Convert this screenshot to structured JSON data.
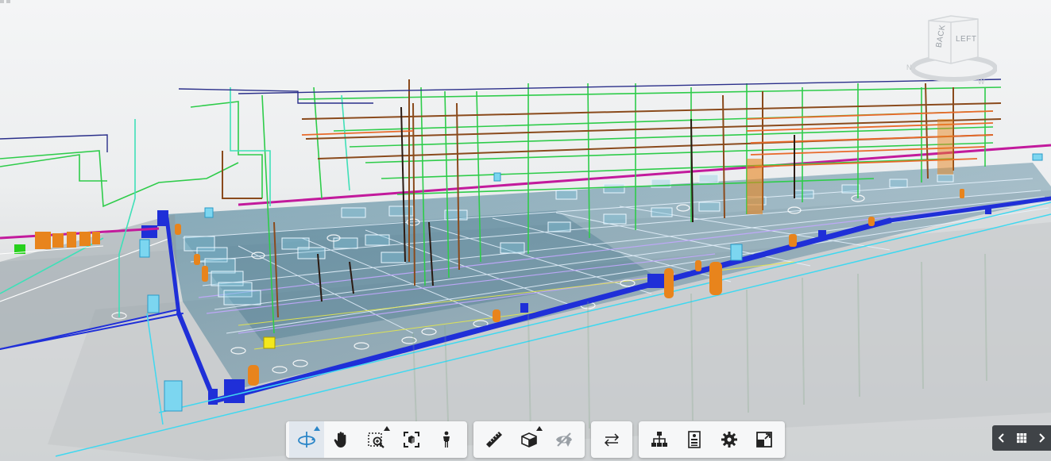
{
  "viewer": {
    "viewcube": {
      "back_label": "BACK",
      "left_label": "LEFT"
    }
  },
  "toolbar": {
    "groups": [
      {
        "name": "navigation",
        "tools": [
          "orbit-icon",
          "pan-icon",
          "zoom-window-icon",
          "fit-to-view-icon",
          "first-person-icon"
        ]
      },
      {
        "name": "analysis",
        "tools": [
          "measure-icon",
          "section-box-icon",
          "hide-object-icon"
        ]
      },
      {
        "name": "compare",
        "tools": [
          "compare-arrows-icon"
        ]
      },
      {
        "name": "settings",
        "tools": [
          "model-browser-icon",
          "properties-icon",
          "settings-gear-icon",
          "fullscreen-icon"
        ]
      }
    ],
    "active_tool": "orbit-icon"
  },
  "nav": {
    "buttons": [
      "prev-chevron-icon",
      "grid-view-icon",
      "next-chevron-icon"
    ]
  },
  "colors": {
    "accent": "#2b86c8",
    "duct_blue": "#1f2fd8",
    "pipe_green": "#2ecc4a",
    "pipe_magenta": "#c21a9c",
    "pipe_brown": "#8a4a1c",
    "pipe_cyan": "#3fe0e0",
    "equipment_orange": "#e8841c",
    "equipment_cyan": "#7cd6f0",
    "slab_fill": "#5a6a78"
  }
}
